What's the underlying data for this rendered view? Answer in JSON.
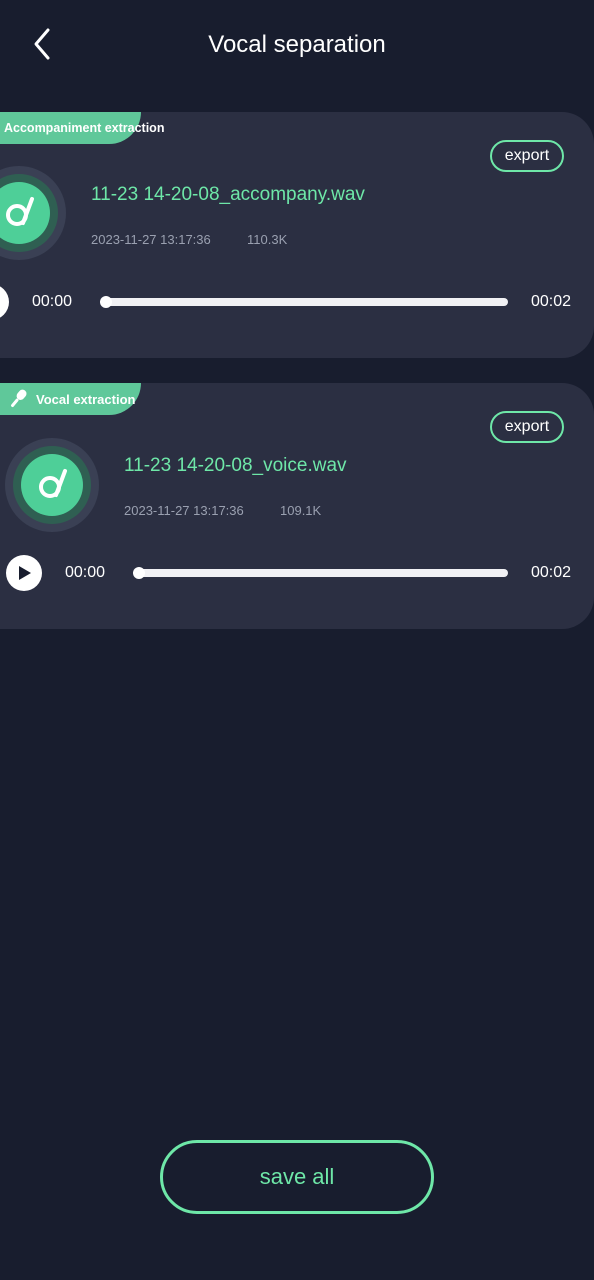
{
  "header": {
    "title": "Vocal separation",
    "back_icon": "chevron-left-icon"
  },
  "colors": {
    "background": "#181d2e",
    "card": "#2b2f42",
    "accent": "#6ee7a8",
    "tag": "#5fc89a"
  },
  "tracks": [
    {
      "tag_label": "Accompaniment extraction",
      "export_label": "export",
      "file_name": "11-23 14-20-08_accompany.wav",
      "date": "2023-11-27 13:17:36",
      "size": "110.3K",
      "current_time": "00:00",
      "duration": "00:02",
      "progress": 0
    },
    {
      "tag_label": "Vocal extraction",
      "tag_icon": "microphone-icon",
      "export_label": "export",
      "file_name": "11-23 14-20-08_voice.wav",
      "date": "2023-11-27 13:17:36",
      "size": "109.1K",
      "current_time": "00:00",
      "duration": "00:02",
      "progress": 0
    }
  ],
  "footer": {
    "save_all_label": "save all"
  }
}
